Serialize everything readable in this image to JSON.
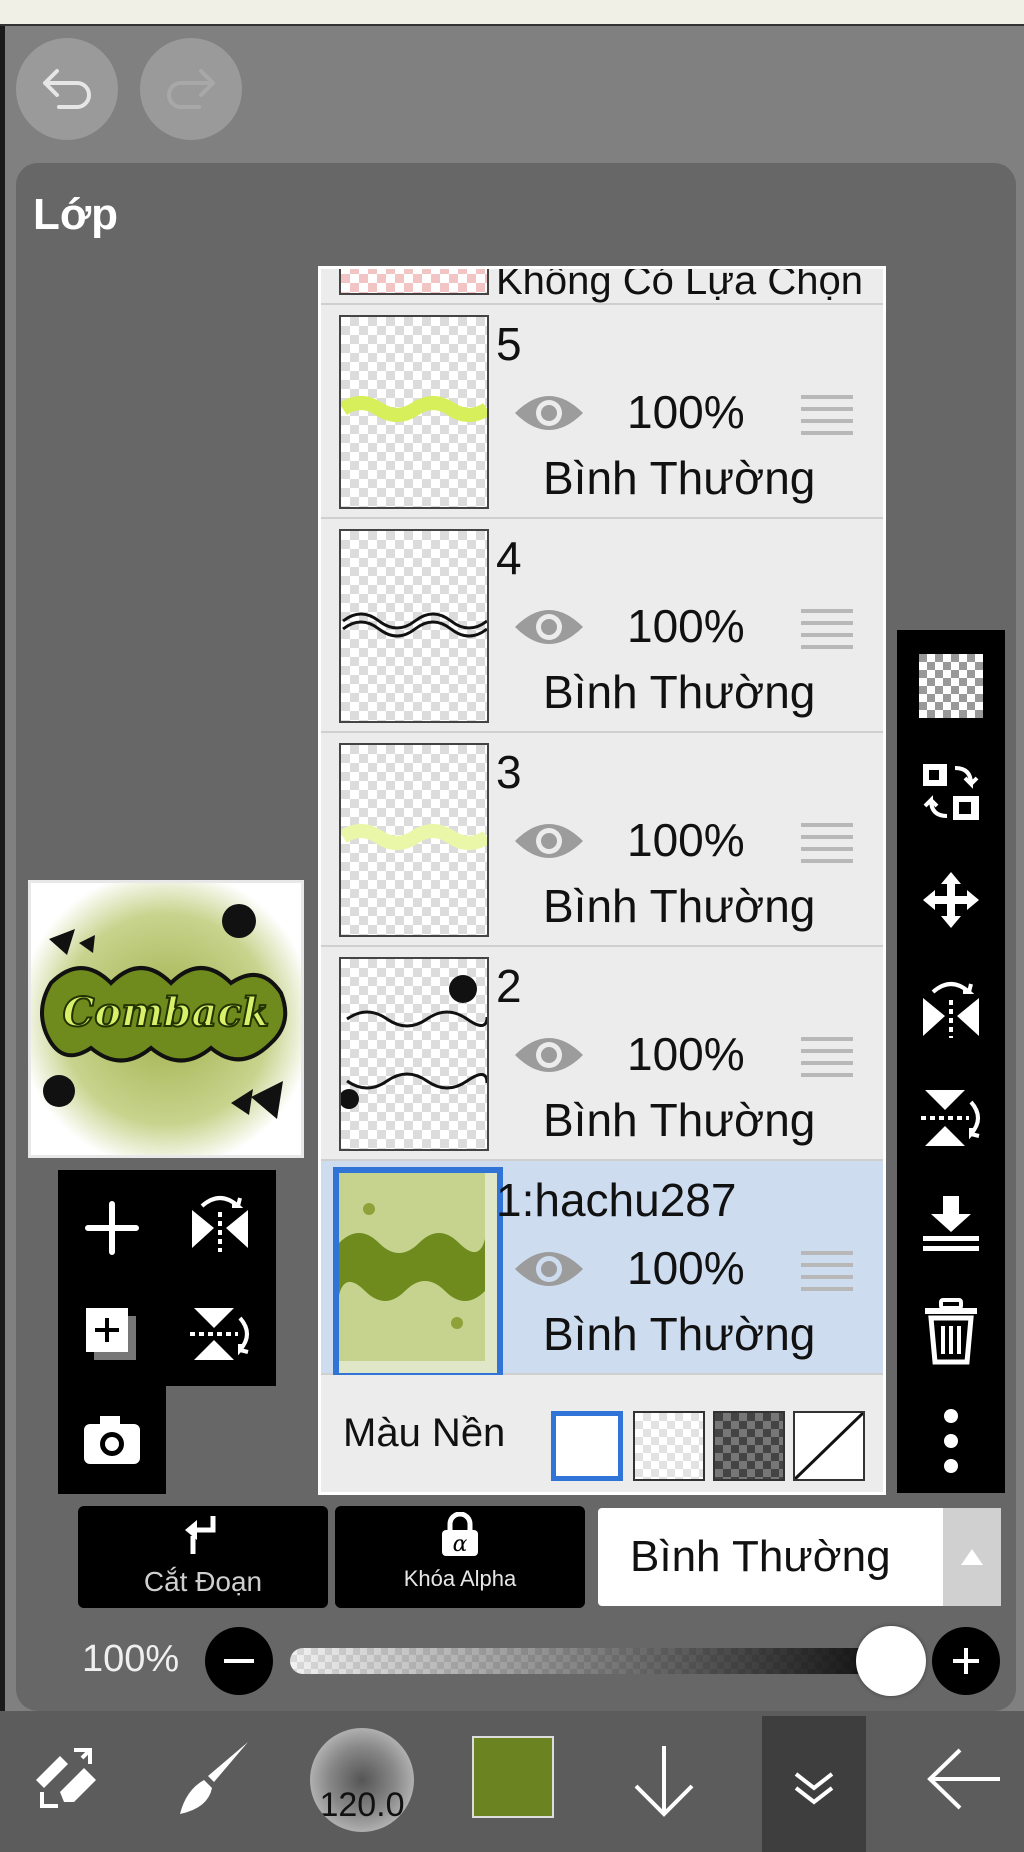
{
  "app": {
    "accent": "#2f74d6",
    "panel_bg": "#676767",
    "selected_row_bg": "#cddcef"
  },
  "panel": {
    "title": "Lớp"
  },
  "layers": {
    "top_partial": {
      "label": "Không Có Lựa Chọn"
    },
    "rows": [
      {
        "name": "5",
        "opacity": "100%",
        "blend": "Bình Thường",
        "visible": true,
        "selected": false
      },
      {
        "name": "4",
        "opacity": "100%",
        "blend": "Bình Thường",
        "visible": true,
        "selected": false
      },
      {
        "name": "3",
        "opacity": "100%",
        "blend": "Bình Thường",
        "visible": true,
        "selected": false
      },
      {
        "name": "2",
        "opacity": "100%",
        "blend": "Bình Thường",
        "visible": true,
        "selected": false
      },
      {
        "name": "1:hachu287",
        "opacity": "100%",
        "blend": "Bình Thường",
        "visible": true,
        "selected": true
      }
    ],
    "background": {
      "label": "Màu Nền",
      "options": [
        "white",
        "transparent-light",
        "transparent-dark",
        "none"
      ],
      "selected": "white"
    }
  },
  "preview": {
    "text": "Comback"
  },
  "bottom_buttons": {
    "clip_label": "Cắt Đoạn",
    "alpha_lock_label": "Khóa Alpha"
  },
  "blend_mode": {
    "value": "Bình Thường"
  },
  "opacity": {
    "label": "100%",
    "value": 1.0
  },
  "toolbar": {
    "brush_size": "120.0",
    "color": "#6b8421"
  },
  "right_tools": [
    "checker-icon",
    "swap-layers-icon",
    "move-icon",
    "flip-horizontal-icon",
    "flip-vertical-icon",
    "merge-down-icon",
    "trash-icon",
    "more-icon"
  ],
  "left_tools": [
    "add-layer-icon",
    "flip-icon",
    "duplicate-icon",
    "flip-vertical-icon",
    "camera-icon"
  ]
}
